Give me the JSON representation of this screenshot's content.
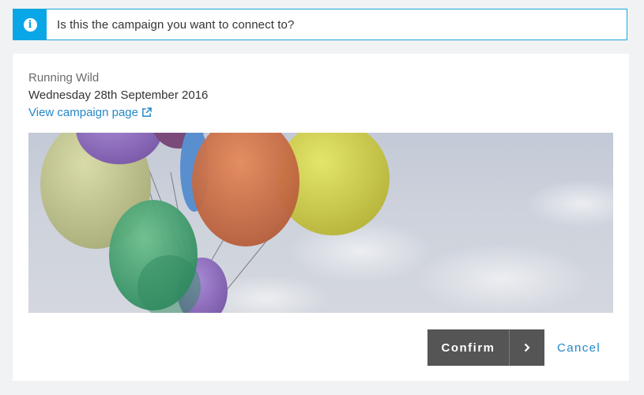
{
  "alert": {
    "icon": "info-icon",
    "message": "Is this the campaign you want to connect to?",
    "accent_color": "#0aa7e8"
  },
  "campaign": {
    "name": "Running Wild",
    "date": "Wednesday 28th September 2016",
    "link_label": "View campaign page",
    "link_icon": "external-link-icon",
    "image": "balloons-banner"
  },
  "actions": {
    "confirm_label": "Confirm",
    "confirm_icon": "chevron-right-icon",
    "cancel_label": "Cancel",
    "link_color": "#2488c8",
    "button_color": "#555555"
  }
}
